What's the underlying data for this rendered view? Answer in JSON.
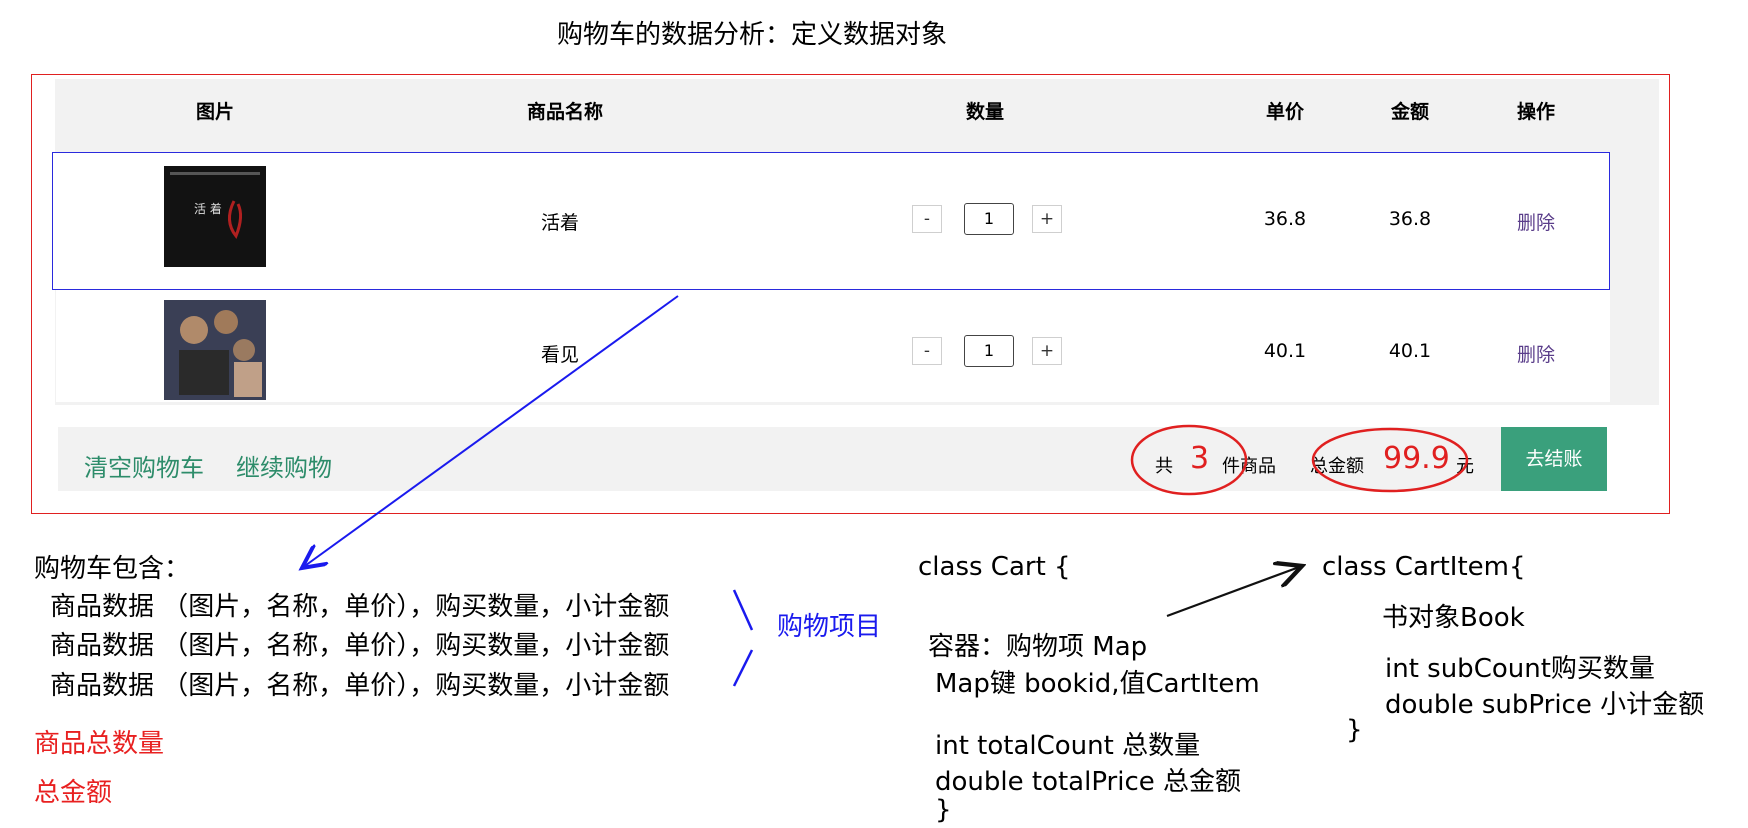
{
  "title": "购物车的数据分析：定义数据对象",
  "cart_table": {
    "headers": [
      "图片",
      "商品名称",
      "数量",
      "单价",
      "金额",
      "操作"
    ],
    "rows": [
      {
        "cover_text": "活 着",
        "name": "活着",
        "quantity": "1",
        "unit_price": "36.8",
        "amount": "36.8",
        "action": "删除"
      },
      {
        "cover_text": "",
        "name": "看见",
        "quantity": "1",
        "unit_price": "40.1",
        "amount": "40.1",
        "action": "删除"
      }
    ],
    "minus": "-",
    "plus": "+"
  },
  "footer": {
    "clear_cart": "清空购物车",
    "continue_shopping": "继续购物",
    "total_prefix": "共",
    "total_count": "3",
    "total_suffix": "件商品",
    "amount_label": "总金额",
    "total_amount": "99.9",
    "currency": "元",
    "checkout": "去结账"
  },
  "notes": {
    "cart_contains": "购物车包含：",
    "item_lines": [
      "商品数据 （图片，名称，单价），购买数量，小计金额",
      "商品数据 （图片，名称，单价），购买数量，小计金额",
      "商品数据 （图片，名称，单价），购买数量，小计金额"
    ],
    "shopping_item": "购物项目",
    "total_count_label": "商品总数量",
    "total_amount_label": "总金额",
    "class_cart": [
      "class Cart {",
      "容器：购物项 Map",
      "Map键 bookid,值CartItem",
      "int totalCount  总数量",
      "double totalPrice 总金额",
      "}"
    ],
    "class_cartitem": [
      "class CartItem{",
      "书对象Book",
      "int subCount购买数量",
      "double subPrice 小计金额",
      "}"
    ]
  },
  "colors": {
    "frame_red": "#e02020",
    "highlight_blue": "#2a2add",
    "link_green": "#2d8c6a",
    "checkout_green": "#3aa07c",
    "delete_purple": "#5a3d8a"
  }
}
